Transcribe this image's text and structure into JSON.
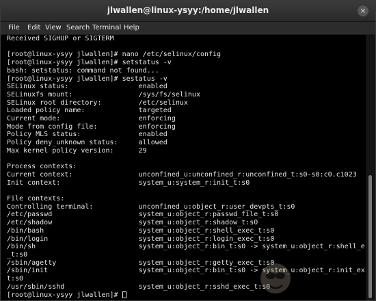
{
  "window": {
    "title": "jlwallen@linux-ysyy:/home/jlwallen",
    "close_glyph": "×"
  },
  "menu": {
    "items": [
      "File",
      "Edit",
      "View",
      "Search",
      "Terminal",
      "Help"
    ]
  },
  "terminal": {
    "lines": [
      "Received SIGHUP or SIGTERM",
      "",
      "[root@linux-ysyy jlwallen]# nano /etc/selinux/config",
      "[root@linux-ysyy jlwallen]# setstatus -v",
      "bash: setstatus: command not found...",
      "[root@linux-ysyy jlwallen]# sestatus -v",
      "SELinux status:                 enabled",
      "SELinuxfs mount:                /sys/fs/selinux",
      "SELinux root directory:         /etc/selinux",
      "Loaded policy name:             targeted",
      "Current mode:                   enforcing",
      "Mode from config file:          enforcing",
      "Policy MLS status:              enabled",
      "Policy deny_unknown status:     allowed",
      "Max kernel policy version:      29",
      "",
      "Process contexts:",
      "Current context:                unconfined_u:unconfined_r:unconfined_t:s0-s0:c0.c1023",
      "Init context:                   system_u:system_r:init_t:s0",
      "",
      "File contexts:",
      "Controlling terminal:           unconfined_u:object_r:user_devpts_t:s0",
      "/etc/passwd                     system_u:object_r:passwd_file_t:s0",
      "/etc/shadow                     system_u:object_r:shadow_t:s0",
      "/bin/bash                       system_u:object_r:shell_exec_t:s0",
      "/bin/login                      system_u:object_r:login_exec_t:s0",
      "/bin/sh                         system_u:object_r:bin_t:s0 -> system_u:object_r:shell_exec",
      "_t:s0",
      "/sbin/agetty                    system_u:object_r:getty_exec_t:s0",
      "/sbin/init                      system_u:object_r:bin_t:s0 -> system_u:object_r:init_exec_",
      "t:s0",
      "/usr/sbin/sshd                  system_u:object_r:sshd_exec_t:s0"
    ],
    "prompt": "[root@linux-ysyy jlwallen]# "
  },
  "colors": {
    "background": "#000000",
    "foreground": "#e6e6e6",
    "titlebar": "#333333"
  },
  "icons": [
    "close-icon",
    "cursor-block",
    "watermark-logo"
  ]
}
